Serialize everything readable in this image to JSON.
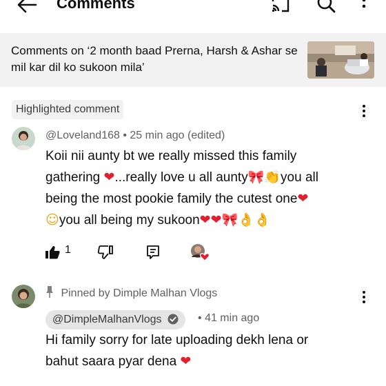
{
  "header": {
    "title": "Comments",
    "back_icon": "arrow-left-icon",
    "cast_icon": "cast-icon",
    "search_icon": "search-icon",
    "menu_icon": "more-vert-icon"
  },
  "banner": {
    "text": "Comments on ‘2 month baad Prerna, Harsh & Ashar se mil kar dil ko sukoon mila’"
  },
  "highlighted": {
    "chip": "Highlighted comment",
    "author": "@Loveland168",
    "separator": "•",
    "time": "25 min ago (edited)",
    "lines": [
      "Koii nii aunty bt we really missed  this family",
      "gathering ",
      "...really love u all aunty",
      "you all",
      "being the most pookie family the cutest one",
      "you all being my sukoon"
    ],
    "like_count": "1"
  },
  "pinned": {
    "pinned_label": "Pinned by Dimple Malhan Vlogs",
    "author": "@DimpleMalhanVlogs",
    "separator": "•",
    "time": "41 min ago",
    "lines": [
      "Hi family sorry for late uploading dekh lena or",
      "bahut saara pyar dena "
    ]
  },
  "colors": {
    "heart": "#e0202c",
    "banner_bg": "#f2f2f2",
    "chip_bg": "#f2f2f2",
    "author_chip_bg": "#e5e5e5"
  }
}
